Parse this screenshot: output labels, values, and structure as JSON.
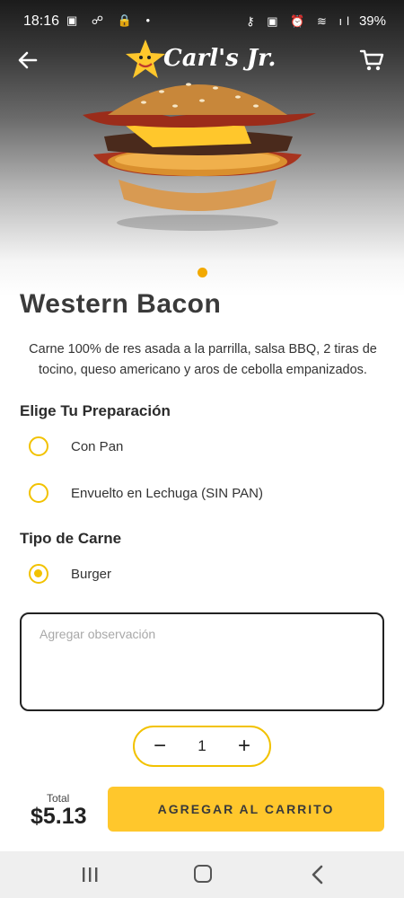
{
  "status_bar": {
    "time": "18:16",
    "left_icons": "▣ ☍ 🔒 •",
    "right_icons": "⚷ ▣ ⏰ ≋ ıl",
    "battery": "39%"
  },
  "header": {
    "logo_text": "Carl's Jr.",
    "logo_icon": "star-icon",
    "back_icon": "arrow-left-icon",
    "cart_icon": "cart-icon"
  },
  "product": {
    "name": "Western Bacon",
    "description": "Carne 100% de res asada a la parrilla, salsa BBQ, 2 tiras de tocino, queso americano y aros de cebolla empanizados."
  },
  "preparation": {
    "title": "Elige Tu Preparación",
    "options": [
      {
        "label": "Con Pan",
        "selected": false
      },
      {
        "label": "Envuelto en Lechuga (SIN PAN)",
        "selected": false
      }
    ]
  },
  "meat": {
    "title": "Tipo de Carne",
    "options": [
      {
        "label": "Burger",
        "selected": true
      }
    ]
  },
  "note": {
    "placeholder": "Agregar observación",
    "value": ""
  },
  "quantity": {
    "minus": "−",
    "value": "1",
    "plus": "+"
  },
  "footer": {
    "total_label": "Total",
    "total_value": "$5.13",
    "add_button": "AGREGAR AL CARRITO"
  },
  "colors": {
    "accent": "#ffc72c",
    "radio": "#f2c200",
    "indicator": "#f2a900"
  }
}
